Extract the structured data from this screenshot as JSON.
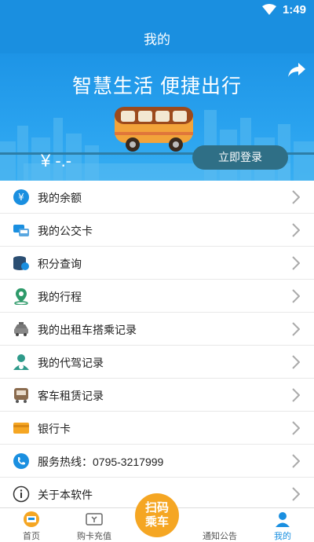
{
  "status": {
    "time": "1:49"
  },
  "header": {
    "title": "我的"
  },
  "banner": {
    "slogan": "智慧生活  便捷出行",
    "balance": "¥ -.-",
    "login_label": "立即登录"
  },
  "menu": [
    {
      "label": "我的余额",
      "icon": "yen-icon"
    },
    {
      "label": "我的公交卡",
      "icon": "bus-card-icon"
    },
    {
      "label": "积分查询",
      "icon": "coins-icon"
    },
    {
      "label": "我的行程",
      "icon": "route-pin-icon"
    },
    {
      "label": "我的出租车搭乘记录",
      "icon": "taxi-icon"
    },
    {
      "label": "我的代驾记录",
      "icon": "driver-icon"
    },
    {
      "label": "客车租赁记录",
      "icon": "coach-bus-icon"
    },
    {
      "label": "银行卡",
      "icon": "bank-card-icon"
    },
    {
      "label": "服务热线：0795-3217999",
      "icon": "phone-icon"
    },
    {
      "label": "关于本软件",
      "icon": "info-icon"
    }
  ],
  "tabs": [
    {
      "label": "首页",
      "icon": "home-icon"
    },
    {
      "label": "购卡充值",
      "icon": "recharge-icon"
    },
    {
      "label": "扫码乘车",
      "icon": "scan-icon"
    },
    {
      "label": "通知公告",
      "icon": "notice-icon"
    },
    {
      "label": "我的",
      "icon": "me-icon"
    }
  ],
  "scan_label": "扫码\n乘车",
  "colors": {
    "primary": "#1a8fe0",
    "login_button": "#2f6f86",
    "scan_button": "#f5a623"
  }
}
